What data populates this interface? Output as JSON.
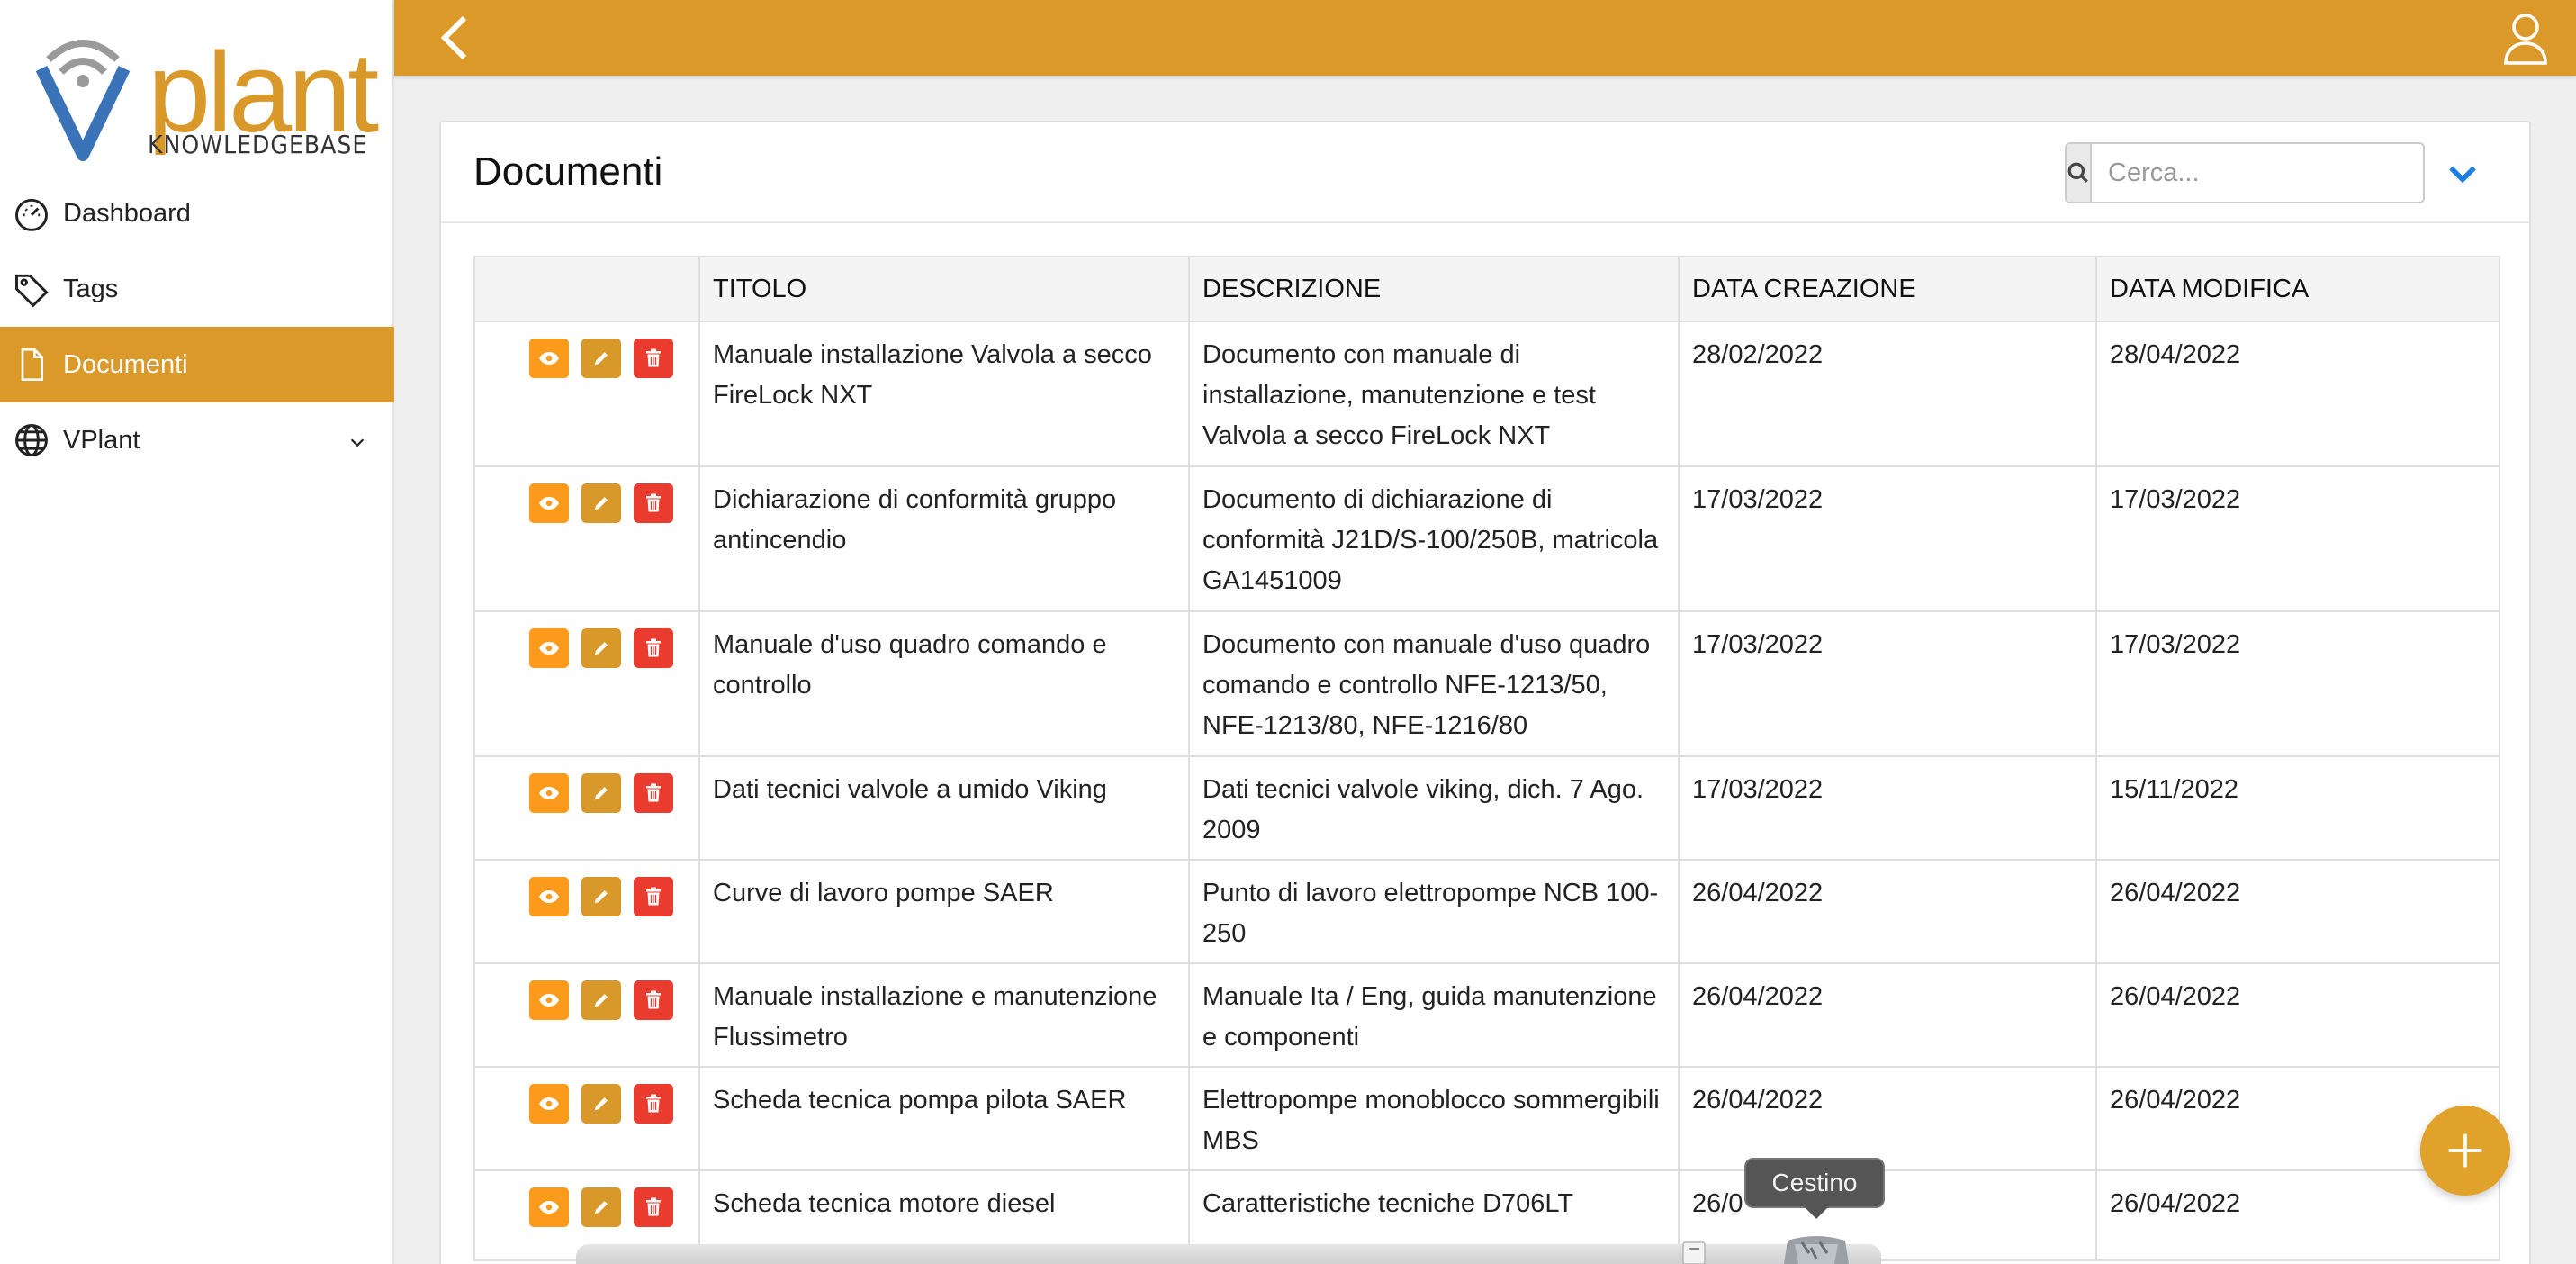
{
  "logo": {
    "brand": "plant",
    "brand_initial": "V",
    "subtitle": "KNOWLEDGEBASE"
  },
  "sidebar": {
    "items": [
      {
        "label": "Dashboard",
        "icon": "gauge-icon"
      },
      {
        "label": "Tags",
        "icon": "tag-icon"
      },
      {
        "label": "Documenti",
        "icon": "file-icon",
        "active": true
      },
      {
        "label": "VPlant",
        "icon": "globe-icon",
        "expandable": true
      }
    ]
  },
  "page": {
    "title": "Documenti",
    "search": {
      "placeholder": "Cerca..."
    }
  },
  "table": {
    "headers": [
      "",
      "TITOLO",
      "DESCRIZIONE",
      "DATA CREAZIONE",
      "DATA MODIFICA"
    ],
    "rows": [
      {
        "titolo": "Manuale installazione Valvola a secco FireLock NXT",
        "descrizione": "Documento con manuale di installazione, manutenzione e test Valvola a secco FireLock NXT",
        "creazione": "28/02/2022",
        "modifica": "28/04/2022"
      },
      {
        "titolo": "Dichiarazione di conformità gruppo antincendio",
        "descrizione": "Documento di dichiarazione di conformità J21D/S-100/250B, matricola GA1451009",
        "creazione": "17/03/2022",
        "modifica": "17/03/2022"
      },
      {
        "titolo": "Manuale d'uso quadro comando e controllo",
        "descrizione": "Documento con manuale d'uso quadro comando e controllo NFE-1213/50, NFE-1213/80, NFE-1216/80",
        "creazione": "17/03/2022",
        "modifica": "17/03/2022"
      },
      {
        "titolo": "Dati tecnici valvole a umido Viking",
        "descrizione": "Dati tecnici valvole viking, dich. 7 Ago. 2009",
        "creazione": "17/03/2022",
        "modifica": "15/11/2022"
      },
      {
        "titolo": "Curve di lavoro pompe SAER",
        "descrizione": "Punto di lavoro elettropompe NCB 100-250",
        "creazione": "26/04/2022",
        "modifica": "26/04/2022"
      },
      {
        "titolo": "Manuale installazione e manutenzione Flussimetro",
        "descrizione": "Manuale Ita / Eng, guida manutenzione e componenti",
        "creazione": "26/04/2022",
        "modifica": "26/04/2022"
      },
      {
        "titolo": "Scheda tecnica pompa pilota SAER",
        "descrizione": "Elettropompe monoblocco sommergibili MBS",
        "creazione": "26/04/2022",
        "modifica": "26/04/2022"
      },
      {
        "titolo": "Scheda tecnica motore diesel",
        "descrizione": "Caratteristiche tecniche D706LT",
        "creazione": "26/0",
        "modifica": "26/04/2022"
      }
    ]
  },
  "dock": {
    "tooltip": "Cestino"
  },
  "colors": {
    "accent": "#db992a",
    "view": "#fb9a1b",
    "edit": "#d9992a",
    "delete": "#ea3b2f",
    "link": "#1a7fe0"
  }
}
